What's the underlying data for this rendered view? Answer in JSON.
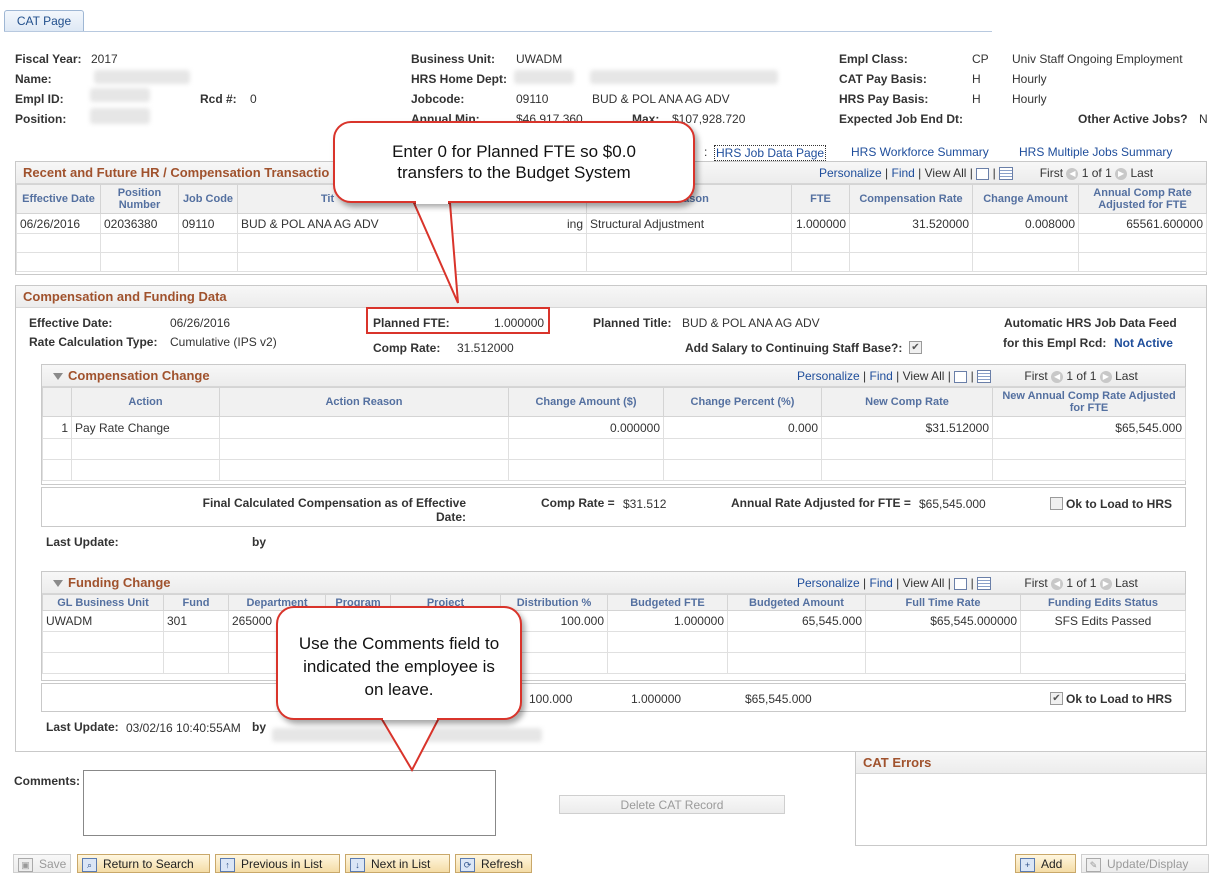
{
  "tab": "CAT Page",
  "header": {
    "fiscal_year_label": "Fiscal Year:",
    "fiscal_year": "2017",
    "name_label": "Name:",
    "empl_id_label": "Empl ID:",
    "rcd_label": "Rcd #:",
    "rcd": "0",
    "position_label": "Position:",
    "business_unit_label": "Business Unit:",
    "business_unit": "UWADM",
    "hrs_home_dept_label": "HRS Home Dept:",
    "jobcode_label": "Jobcode:",
    "jobcode": "09110",
    "jobcode_title": "BUD & POL ANA AG ADV",
    "annual_min_label": "Annual Min:",
    "annual_min": "$46,917.360",
    "max_label": "Max:",
    "max": "$107,928.720",
    "empl_class_label": "Empl Class:",
    "empl_class": "CP",
    "empl_class_desc": "Univ Staff Ongoing Employment",
    "cat_pay_basis_label": "CAT Pay Basis:",
    "cat_pay_basis": "H",
    "cat_pay_basis_desc": "Hourly",
    "hrs_pay_basis_label": "HRS Pay Basis:",
    "hrs_pay_basis": "H",
    "hrs_pay_basis_desc": "Hourly",
    "expected_end_label": "Expected Job End Dt:",
    "other_jobs_label": "Other Active Jobs?",
    "other_jobs": "N",
    "links_prefix": ":",
    "link_job_data": "HRS Job Data Page",
    "link_workforce": "HRS Workforce Summary",
    "link_multiple_jobs": "HRS Multiple Jobs Summary"
  },
  "recent": {
    "title": "Recent and Future HR / Compensation Transactio",
    "nav": {
      "personalize": "Personalize",
      "find": "Find",
      "view_all": "View All",
      "first": "First",
      "range": "1 of 1",
      "last": "Last"
    },
    "columns": [
      "Effective Date",
      "Position Number",
      "Job Code",
      "Tit",
      "Reason",
      "FTE",
      "Compensation Rate",
      "Change Amount",
      "Annual Comp Rate Adjusted for FTE"
    ],
    "rows": [
      {
        "eff_date": "06/26/2016",
        "position": "02036380",
        "job_code": "09110",
        "title": "BUD & POL ANA AG ADV",
        "action": "ing",
        "reason": "Structural Adjustment",
        "fte": "1.000000",
        "comp_rate": "31.520000",
        "change": "0.008000",
        "annual": "65561.600000"
      }
    ]
  },
  "comp_funding": {
    "title": "Compensation and Funding Data",
    "eff_date_label": "Effective Date:",
    "eff_date": "06/26/2016",
    "rate_calc_label": "Rate Calculation Type:",
    "rate_calc": "Cumulative (IPS v2)",
    "planned_fte_label": "Planned FTE:",
    "planned_fte": "1.000000",
    "comp_rate_label": "Comp Rate:",
    "comp_rate": "31.512000",
    "planned_title_label": "Planned Title:",
    "planned_title": "BUD & POL ANA AG ADV",
    "add_salary_label": "Add Salary to Continuing Staff Base?:",
    "auto_feed_label_1": "Automatic HRS Job Data Feed",
    "auto_feed_label_2": "for this Empl Rcd:",
    "auto_feed_value": "Not Active"
  },
  "comp_change": {
    "title": "Compensation Change",
    "nav": {
      "personalize": "Personalize",
      "find": "Find",
      "view_all": "View All",
      "first": "First",
      "range": "1 of 1",
      "last": "Last"
    },
    "columns": [
      "Action",
      "Action Reason",
      "Change Amount ($)",
      "Change Percent (%)",
      "New Comp Rate",
      "New Annual Comp Rate Adjusted for FTE"
    ],
    "rows": [
      {
        "num": "1",
        "action": "Pay Rate Change",
        "reason": "",
        "amount": "0.000000",
        "percent": "0.000",
        "new_rate": "$31.512000",
        "new_annual": "$65,545.000"
      }
    ],
    "final_label": "Final Calculated Compensation as of Effective Date:",
    "final_comp_label": "Comp Rate =",
    "final_comp": "$31.512",
    "final_annual_label": "Annual Rate Adjusted for FTE =",
    "final_annual": "$65,545.000",
    "ok_label": "Ok to Load to HRS",
    "last_update_label": "Last Update:",
    "by_label": "by"
  },
  "funding_change": {
    "title": "Funding Change",
    "nav": {
      "personalize": "Personalize",
      "find": "Find",
      "view_all": "View All",
      "first": "First",
      "range": "1 of 1",
      "last": "Last"
    },
    "columns": [
      "GL Business Unit",
      "Fund",
      "Department",
      "Program",
      "Project",
      "Distribution %",
      "Budgeted FTE",
      "Budgeted Amount",
      "Full Time Rate",
      "Funding Edits Status"
    ],
    "rows": [
      {
        "gl_bu": "UWADM",
        "fund": "301",
        "dept": "265000",
        "program": "",
        "project": "",
        "dist": "100.000",
        "fte": "1.000000",
        "amount": "65,545.000",
        "rate": "$65,545.000000",
        "status": "SFS Edits Passed"
      }
    ],
    "total_dist": "100.000",
    "total_fte": "1.000000",
    "total_amount": "$65,545.000",
    "ok_label": "Ok to Load to HRS",
    "last_update_label": "Last Update:",
    "last_update": "03/02/16 10:40:55AM",
    "by_label": "by"
  },
  "cat_errors_title": "CAT Errors",
  "comments_label": "Comments:",
  "delete_button": "Delete CAT Record",
  "toolbar": {
    "save": "Save",
    "return": "Return to Search",
    "previous": "Previous in List",
    "next": "Next in List",
    "refresh": "Refresh",
    "add": "Add",
    "update": "Update/Display"
  },
  "callouts": {
    "fte": "Enter 0 for Planned FTE so $0.0 transfers to the Budget System",
    "comments": "Use the Comments field to indicated the employee is on leave."
  }
}
